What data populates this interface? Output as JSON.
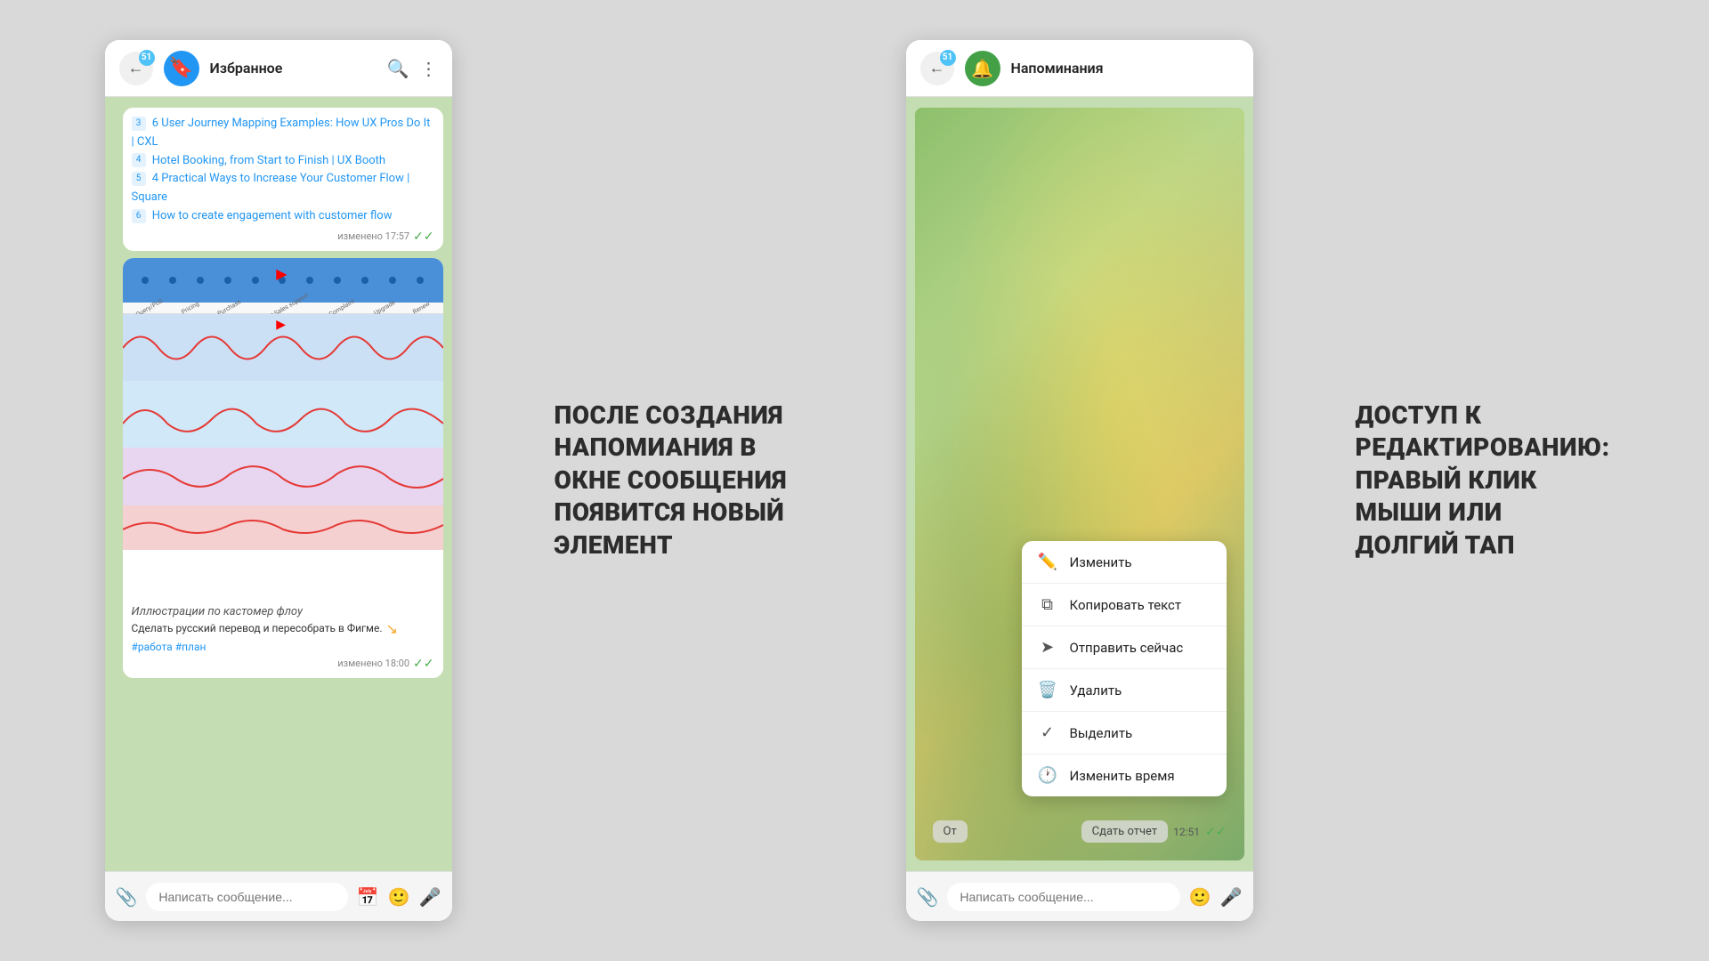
{
  "left_chat": {
    "title": "Избранное",
    "badge": "51",
    "back_tooltip": "Back",
    "search_tooltip": "Search",
    "more_tooltip": "More",
    "messages": [
      {
        "id": "msg1",
        "links": [
          {
            "num": "3",
            "text": "6 User Journey Mapping Examples: How UX Pros Do It | CXL"
          },
          {
            "num": "4",
            "text": "Hotel Booking, from Start to Finish | UX Booth"
          },
          {
            "num": "5",
            "text": "4 Practical Ways to Increase Your Customer Flow | Square"
          },
          {
            "num": "6",
            "text": "How to create engagement with customer flow"
          }
        ],
        "time": "изменено 17:57",
        "status": "✓✓"
      }
    ],
    "image_caption": "Иллюстрации по кастомер флоу",
    "task_note": "Сделать русский перевод и пересобрать в Фигме.",
    "hashtags": "#работа #план",
    "image_time": "изменено 18:00",
    "image_status": "✓✓",
    "input_placeholder": "Написать сообщение...",
    "cf_labels": [
      "Query/PoS",
      "Pricing",
      "Purchase",
      "Post Sales support",
      "Complaint",
      "Upgrade",
      "Renew"
    ]
  },
  "annotation_left": {
    "text": "ПОСЛЕ СОЗДАНИЯ НАПОМИАНИЯ В ОКНЕ СООБЩЕНИЯ ПОЯВИТСЯ НОВЫЙ ЭЛЕМЕНТ"
  },
  "right_chat": {
    "title": "Напоминания",
    "badge": "51",
    "input_placeholder": "Написать сообщение...",
    "ot_label": "От",
    "report_label": "Сдать отчет",
    "time": "12:51",
    "status": "✓✓",
    "context_menu": {
      "items": [
        {
          "icon": "✏️",
          "label": "Изменить",
          "name": "edit"
        },
        {
          "icon": "📋",
          "label": "Копировать текст",
          "name": "copy-text"
        },
        {
          "icon": "➤",
          "label": "Отправить сейчас",
          "name": "send-now"
        },
        {
          "icon": "🗑️",
          "label": "Удалить",
          "name": "delete"
        },
        {
          "icon": "✓",
          "label": "Выделить",
          "name": "select"
        },
        {
          "icon": "🕐",
          "label": "Изменить время",
          "name": "change-time"
        }
      ]
    }
  },
  "annotation_right": {
    "text": "ДОСТУП К РЕДАКТИРОВАНИЮ: ПРАВЫЙ КЛИК МЫШИ ИЛИ ДОЛГИЙ ТАП"
  },
  "icons": {
    "back": "←",
    "search": "🔍",
    "more": "⋮",
    "attachment": "📎",
    "calendar": "📅",
    "emoji": "🙂",
    "mic": "🎤",
    "edit_pencil": "✏️",
    "copy": "⧉",
    "send": "➤",
    "trash": "🗑️",
    "check": "✓",
    "clock": "🕐"
  },
  "colors": {
    "telegram_blue": "#2196F3",
    "chat_bg": "#c5ddb2",
    "header_bg": "#ffffff",
    "bubble_bg": "#ffffff",
    "green_check": "#4CAF50"
  }
}
